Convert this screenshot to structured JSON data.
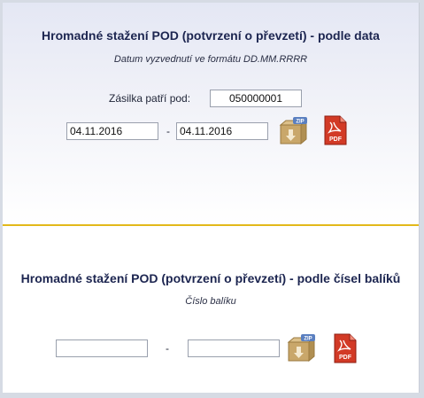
{
  "by_date": {
    "title": "Hromadné stažení POD (potvrzení o převzetí) - podle data",
    "subtitle": "Datum vyzvednutí ve formátu DD.MM.RRRR",
    "shipment_label": "Zásilka patří pod:",
    "shipment_value": "050000001",
    "date_from": "04.11.2016",
    "date_to": "04.11.2016",
    "separator": "-",
    "zip_badge": "ZIP",
    "pdf_badge": "PDF"
  },
  "by_parcel": {
    "title": "Hromadné stažení POD (potvrzení o převzetí) - podle čísel balíků",
    "subtitle": "Číslo balíku",
    "parcel_from": "",
    "parcel_to": "",
    "separator": "-",
    "zip_badge": "ZIP",
    "pdf_badge": "PDF"
  },
  "colors": {
    "title": "#1c2550",
    "divider": "#e3b91a",
    "pdf_red": "#c8261a",
    "zip_box": "#c9a76a"
  },
  "icons": [
    "zip-download-icon",
    "pdf-download-icon"
  ]
}
